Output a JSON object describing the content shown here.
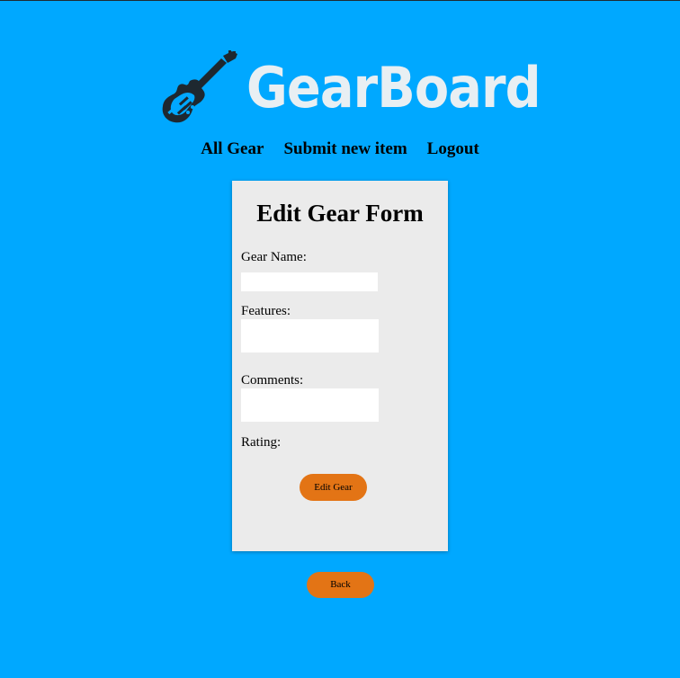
{
  "brand": {
    "name": "GearBoard",
    "icon": "electric-guitar-icon"
  },
  "nav": {
    "items": [
      {
        "label": "All Gear"
      },
      {
        "label": "Submit new item"
      },
      {
        "label": "Logout"
      }
    ]
  },
  "form": {
    "title": "Edit Gear Form",
    "gear_name_label": "Gear Name:",
    "gear_name_value": "",
    "features_label": "Features:",
    "features_value": "",
    "comments_label": "Comments:",
    "comments_value": "",
    "rating_label": "Rating:",
    "submit_label": "Edit Gear"
  },
  "back_label": "Back",
  "colors": {
    "background": "#00a8ff",
    "card": "#ebebeb",
    "button": "#e37415",
    "logo_text": "#e8eff3",
    "guitar": "#1e2830"
  }
}
